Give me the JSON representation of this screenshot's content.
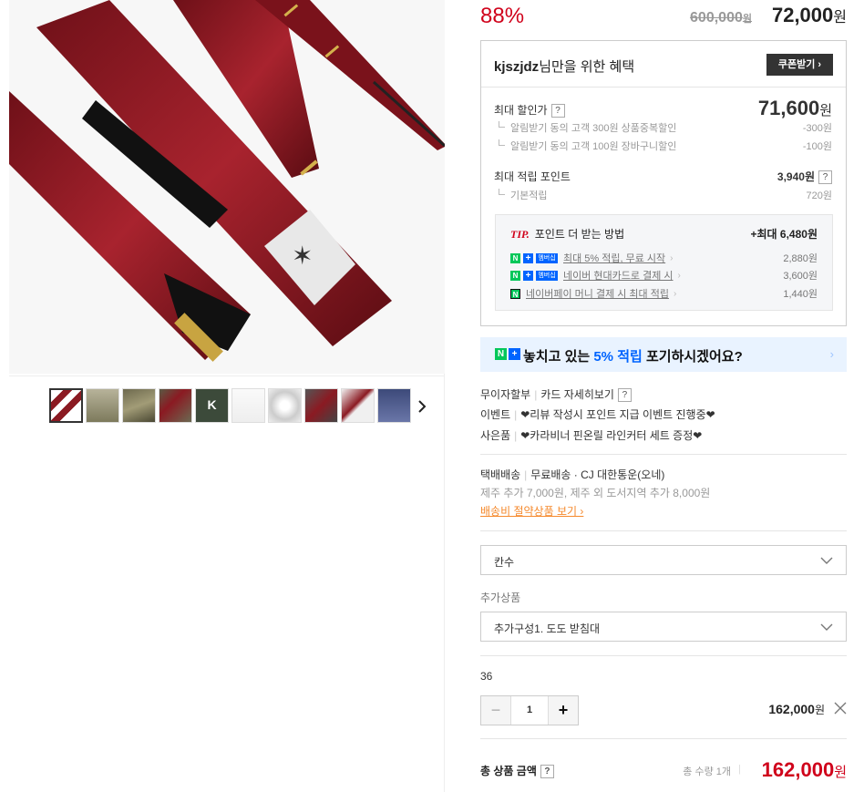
{
  "price": {
    "discount_rate": "88%",
    "original": "600,000",
    "original_unit": "원",
    "sale": "72,000",
    "sale_unit": "원"
  },
  "benefit": {
    "user": "kjszjdz",
    "title_suffix": "님만을 위한 혜택",
    "coupon_button": "쿠폰받기 ›",
    "max_discount_label": "최대 할인가",
    "max_discount_value": "71,600",
    "max_discount_unit": "원",
    "discount_items": [
      {
        "label": "알림받기 동의 고객 300원 상품중복할인",
        "value": "-300원"
      },
      {
        "label": "알림받기 동의 고객 100원 장바구니할인",
        "value": "-100원"
      }
    ],
    "max_point_label": "최대 적립 포인트",
    "max_point_value": "3,940원",
    "point_items": [
      {
        "label": "기본적립",
        "value": "720원"
      }
    ],
    "tip": {
      "tag": "TIP.",
      "title": "포인트 더 받는 방법",
      "max": "+최대 6,480원",
      "rows": [
        {
          "badge": "멤버십",
          "text": "최대 5% 적립, 무료 시작",
          "value": "2,880원"
        },
        {
          "badge": "멤버십",
          "text": "네이버 현대카드로 결제 시",
          "value": "3,600원"
        },
        {
          "badge": "",
          "text": "네이버페이 머니 결제 시 최대 적립",
          "value": "1,440원"
        }
      ]
    },
    "question_mark": "?"
  },
  "naver_banner": {
    "msg_before": "놓치고 있는 ",
    "msg_highlight": "5% 적립",
    "msg_after": " 포기하시겠어요?",
    "n": "N",
    "plus": "+"
  },
  "info": {
    "installment": "무이자할부",
    "card_detail": "카드 자세히보기",
    "event_label": "이벤트",
    "event_text": "❤리뷰 작성시 포인트 지급 이벤트 진행중❤",
    "gift_label": "사은품",
    "gift_text": "❤카라비너 핀온릴 라인커터 세트 증정❤"
  },
  "shipping": {
    "method": "택배배송",
    "detail": "무료배송 · CJ 대한통운(오네)",
    "extra": "제주 추가 7,000원, 제주 외 도서지역 추가 8,000원",
    "link": "배송비 절약상품 보기 ›"
  },
  "options": {
    "select1": "칸수",
    "extra_label": "추가상품",
    "select2": "추가구성1. 도도 받침대"
  },
  "selected": {
    "option_name": "36",
    "quantity": "1",
    "minus": "−",
    "plus": "+",
    "price": "162,000",
    "price_unit": "원"
  },
  "total": {
    "label": "총 상품 금액",
    "qty_text": "총 수량 1개",
    "sep": "|",
    "price": "162,000",
    "price_unit": "원"
  },
  "colors": {
    "accent_red": "#d0021b",
    "naver_green": "#03c75a",
    "naver_blue": "#0064ff",
    "rod_red": "#8b1a22"
  }
}
